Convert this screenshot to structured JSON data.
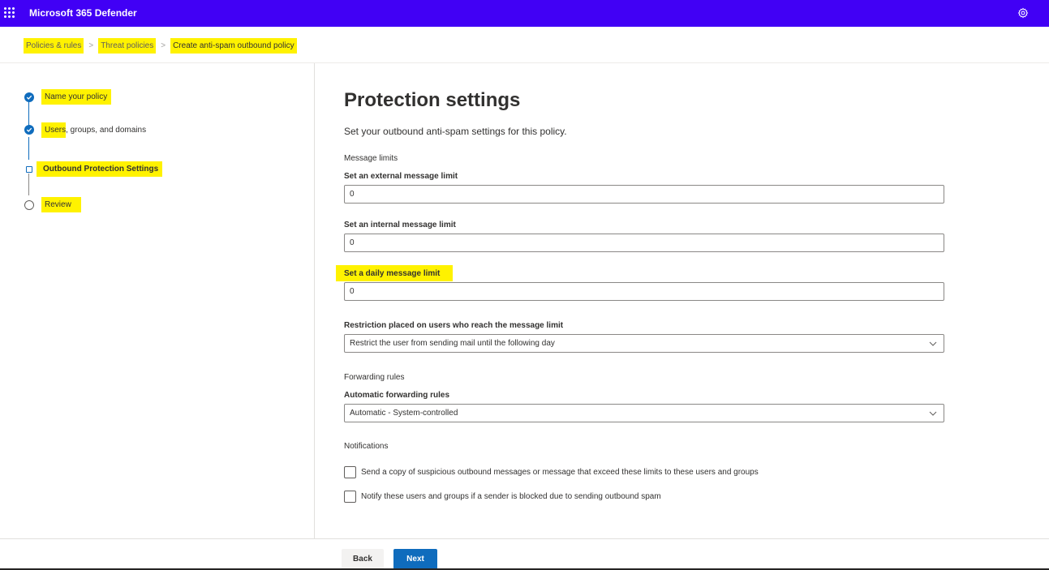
{
  "header": {
    "app_title": "Microsoft 365 Defender",
    "bar_color": "#4100f5"
  },
  "breadcrumb": {
    "items": [
      "Policies & rules",
      "Threat policies",
      "Create anti-spam outbound policy"
    ],
    "separator": ">"
  },
  "steps": [
    {
      "label": "Name your policy",
      "state": "done"
    },
    {
      "label_highlighted": "Users",
      "label_rest": ", groups, and domains",
      "state": "done"
    },
    {
      "label": "Outbound Protection Settings",
      "state": "current"
    },
    {
      "label": "Review",
      "state": "todo"
    }
  ],
  "main": {
    "title": "Protection settings",
    "subtitle": "Set your outbound anti-spam settings for this policy.",
    "message_limits": {
      "section": "Message limits",
      "external_label": "Set an external message limit",
      "external_value": "0",
      "internal_label": "Set an internal message limit",
      "internal_value": "0",
      "daily_label": "Set a daily message limit",
      "daily_value": "0"
    },
    "restriction": {
      "label": "Restriction placed on users who reach the message limit",
      "selected": "Restrict the user from sending mail until the following day"
    },
    "forwarding": {
      "section": "Forwarding rules",
      "label": "Automatic forwarding rules",
      "selected": "Automatic - System-controlled"
    },
    "notifications": {
      "section": "Notifications",
      "option1": "Send a copy of suspicious outbound messages or message that exceed these limits to these users and groups",
      "option2": "Notify these users and groups if a sender is blocked due to sending outbound spam"
    }
  },
  "footer": {
    "back_label": "Back",
    "next_label": "Next",
    "primary_color": "#0f6cbd"
  },
  "highlight_color": "#fff200"
}
